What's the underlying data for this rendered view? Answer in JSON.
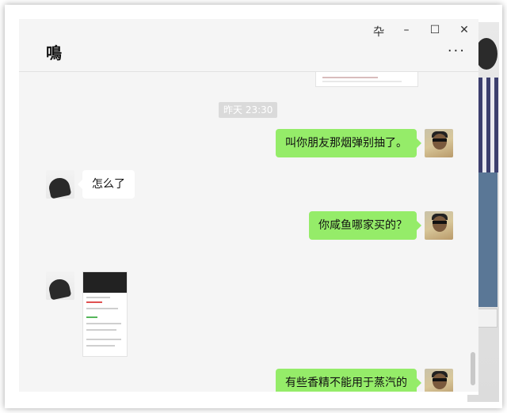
{
  "window": {
    "title": "鳴",
    "controls": {
      "pin": "卆",
      "minimize": "–",
      "maximize": "☐",
      "close": "✕"
    },
    "more": "···"
  },
  "chat": {
    "timestamp": "昨天 23:30",
    "messages": [
      {
        "sender": "me",
        "text": "叫你朋友那烟弹别抽了。"
      },
      {
        "sender": "them",
        "text": "怎么了"
      },
      {
        "sender": "me",
        "text": "你咸鱼哪家买的？"
      },
      {
        "sender": "them",
        "type": "image"
      },
      {
        "sender": "me",
        "text": "有些香精不能用于蒸汽的"
      }
    ]
  },
  "colors": {
    "my_bubble": "#95ec69",
    "their_bubble": "#ffffff",
    "chat_background": "#f5f5f5",
    "timestamp_bg": "#dadada"
  }
}
